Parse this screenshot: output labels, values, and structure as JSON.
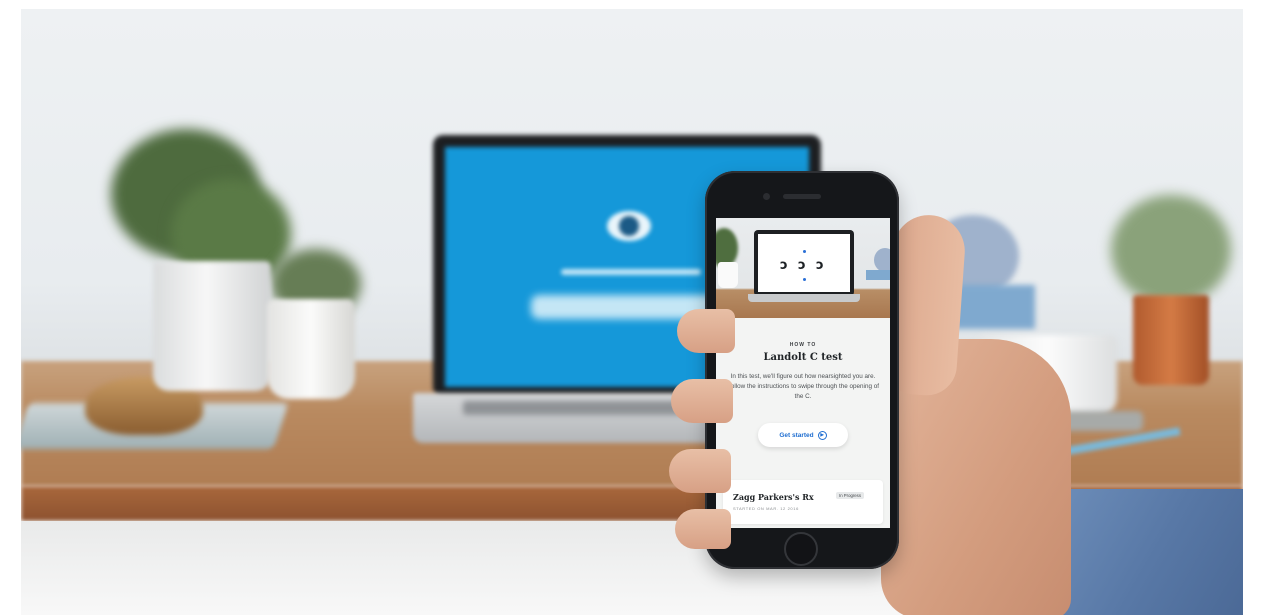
{
  "scene": {
    "description_colors": {
      "laptop_screen": "#1598d9",
      "desk_wood": "#b98a60",
      "phone_body": "#15171a",
      "accent_blue": "#1f6ed1"
    }
  },
  "phone_app": {
    "hero_symbols": [
      "ɔ",
      "ɔ",
      "ɔ"
    ],
    "eyebrow": "HOW TO",
    "title": "Landolt C test",
    "description": "In this test, we'll figure out how nearsighted you are. Follow the instructions to swipe through the opening of the C.",
    "cta_label": "Get started",
    "cta_icon": "play-circle-icon",
    "card": {
      "name": "Zagg Parkers's Rx",
      "subtitle": "STARTED ON MAR. 12 2016",
      "badge": "In Progress"
    }
  }
}
